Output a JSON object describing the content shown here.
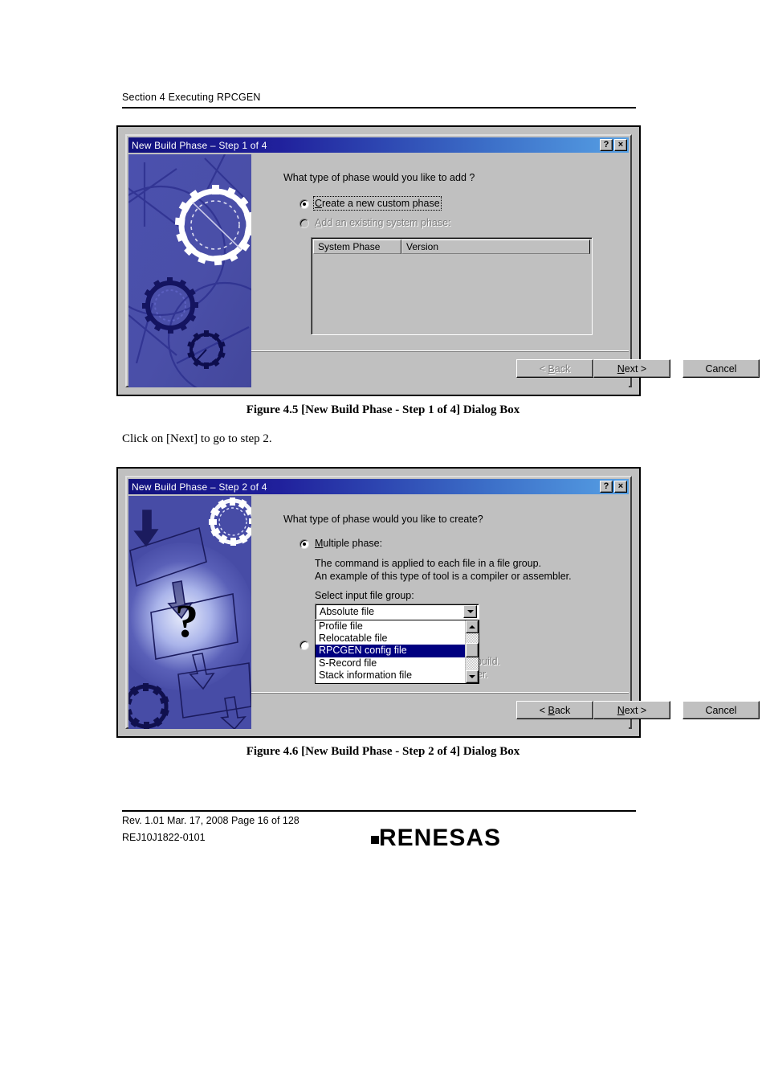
{
  "page_header": {
    "section": "Section 4   Executing RPCGEN"
  },
  "figure1": {
    "caption": "Figure 4.5   [New Build Phase - Step 1 of 4] Dialog Box",
    "dialog": {
      "title": "New Build Phase – Step 1 of 4",
      "help_button": "?",
      "close_button": "×",
      "question": "What type of phase would you like to add ?",
      "radio1": {
        "label": "Create a new custom phase",
        "accel": "C",
        "checked": true,
        "enabled": true
      },
      "radio2": {
        "label": "Add an existing system phase:",
        "accel": "A",
        "checked": false,
        "enabled": false
      },
      "listview": {
        "columns": [
          "System Phase",
          "Version"
        ],
        "rows": []
      },
      "buttons": {
        "back": {
          "label": "< Back",
          "accel": "B",
          "enabled": false
        },
        "next": {
          "label": "Next >",
          "accel": "N",
          "enabled": true
        },
        "cancel": {
          "label": "Cancel",
          "enabled": true
        }
      }
    }
  },
  "body_text_1": "Click on [Next] to go to step 2.",
  "figure2": {
    "caption": "Figure 4.6   [New Build Phase - Step 2 of 4] Dialog Box",
    "dialog": {
      "title": "New Build Phase – Step 2 of 4",
      "help_button": "?",
      "close_button": "×",
      "question": "What type of phase would you like to create?",
      "radio1": {
        "label": "Multiple phase:",
        "accel": "M",
        "checked": true,
        "enabled": true
      },
      "desc1_line1": "The command is applied to each file in a file group.",
      "desc1_line2": "An example of this type of tool is a compiler or assembler.",
      "combo_label": "Select input file group:",
      "combo_label_accel": "i",
      "combo_value": "Absolute file",
      "dropdown_options": [
        "Profile file",
        "Relocatable file",
        "RPCGEN config file",
        "S-Record file",
        "Stack information file"
      ],
      "dropdown_selected": "RPCGEN config file",
      "radio2": {
        "label": "",
        "checked": false,
        "enabled": true
      },
      "desc2_line1_tail": "nce per build.",
      "desc2_line2_tail": "nker.",
      "buttons": {
        "back": {
          "label": "< Back",
          "accel": "B",
          "enabled": true
        },
        "next": {
          "label": "Next >",
          "accel": "N",
          "enabled": true
        },
        "cancel": {
          "label": "Cancel",
          "enabled": true
        }
      }
    }
  },
  "footer": {
    "line1": "Rev. 1.01  Mar. 17, 2008  Page 16 of 128",
    "line2": "REJ10J1822-0101",
    "logo_text": "RENESAS"
  },
  "colors": {
    "title_left": "#12127e",
    "title_right": "#56a0e4",
    "dialog_face": "#c0c0c0",
    "selection": "#000080",
    "art_blue": "#4a4fa8"
  }
}
